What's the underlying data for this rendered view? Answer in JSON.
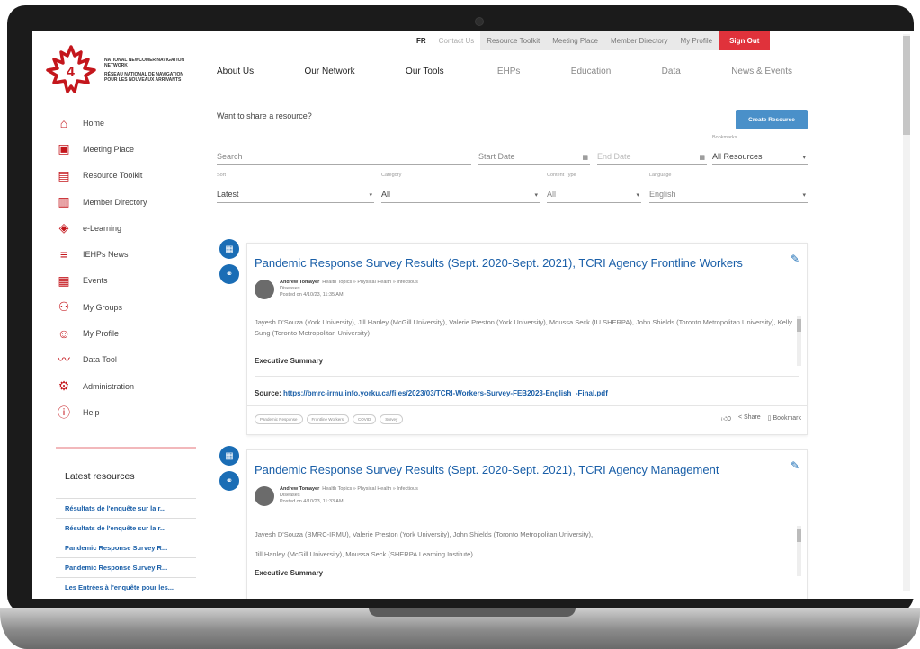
{
  "logo": {
    "line1": "National Newcomer Navigation Network",
    "line2": "Réseau national de navigation pour les nouveaux arrivants"
  },
  "util_nav": {
    "lang": "FR",
    "contact": "Contact Us",
    "resource_toolkit": "Resource Toolkit",
    "meeting_place": "Meeting Place",
    "member_directory": "Member Directory",
    "my_profile": "My Profile",
    "sign_out": "Sign Out"
  },
  "main_nav": [
    "About Us",
    "Our Network",
    "Our Tools",
    "IEHPs",
    "Education",
    "Data",
    "News & Events"
  ],
  "sidebar": {
    "items": [
      {
        "label": "Home",
        "icon": "home-icon"
      },
      {
        "label": "Meeting Place",
        "icon": "chat-icon"
      },
      {
        "label": "Resource Toolkit",
        "icon": "document-icon"
      },
      {
        "label": "Member Directory",
        "icon": "book-icon"
      },
      {
        "label": "e-Learning",
        "icon": "graduation-cap-icon"
      },
      {
        "label": "IEHPs News",
        "icon": "menu-lines-icon"
      },
      {
        "label": "Events",
        "icon": "calendar-icon"
      },
      {
        "label": "My Groups",
        "icon": "group-icon"
      },
      {
        "label": "My Profile",
        "icon": "user-icon"
      },
      {
        "label": "Data Tool",
        "icon": "trend-icon"
      },
      {
        "label": "Administration",
        "icon": "gear-icon"
      },
      {
        "label": "Help",
        "icon": "info-icon"
      }
    ],
    "latest_title": "Latest resources",
    "latest": [
      "Résultats de l'enquête sur la r...",
      "Résultats de l'enquête sur la r...",
      "Pandemic Response Survey R...",
      "Pandemic Response Survey R...",
      "Les Entrées à l'enquête pour les..."
    ]
  },
  "toolbar": {
    "share_prompt": "Want to share a resource?",
    "create_button": "Create Resource"
  },
  "filters": {
    "search_placeholder": "Search",
    "start_date": "Start Date",
    "end_date": "End Date",
    "bookmarks_label": "Bookmarks",
    "bookmarks_value": "All Resources",
    "sort_label": "Sort",
    "sort_value": "Latest",
    "category_label": "Category",
    "category_value": "All",
    "content_type_label": "Content Type",
    "content_type_value": "All",
    "language_label": "Language",
    "language_value": "English"
  },
  "cards": [
    {
      "title": "Pandemic Response Survey Results (Sept. 2020-Sept. 2021), TCRI Agency Frontline Workers",
      "author": "Andrew Tomayer",
      "topic": "Health Topics » Physical Health » Infectious",
      "topic2": "Diseases",
      "posted": "Posted on 4/10/23, 11:35 AM",
      "body": "Jayesh D'Souza (York University), Jill Hanley (McGill University), Valerie Preston (York University), Moussa Seck (IU SHERPA), John Shields (Toronto Metropolitan University), Kelly Sung (Toronto Metropolitan University)",
      "exec": "Executive Summary",
      "source_label": "Source:",
      "source_url": "https://bmrc-irmu.info.yorku.ca/files/2023/03/TCRI-Workers-Survey-FEB2023-English_-Final.pdf",
      "tags": [
        "Pandemic Response",
        "Frontline Workers",
        "COVID",
        "Survey"
      ],
      "likes": "0",
      "share": "Share",
      "bookmark": "Bookmark"
    },
    {
      "title": "Pandemic Response Survey Results (Sept. 2020-Sept. 2021), TCRI Agency Management",
      "author": "Andrew Tomayer",
      "topic": "Health Topics » Physical Health » Infectious",
      "topic2": "Diseases",
      "posted": "Posted on 4/10/23, 11:33 AM",
      "body": "Jayesh D'Souza (BMRC-IRMU), Valerie Preston (York University), John Shields (Toronto Metropolitan University),",
      "body2": "Jill Hanley (McGill University), Moussa Seck (SHERPA Learning Institute)",
      "exec": "Executive Summary"
    }
  ],
  "colors": {
    "brand_red": "#e0323b",
    "link_blue": "#1a5fa8",
    "button_blue": "#4a90c9"
  }
}
